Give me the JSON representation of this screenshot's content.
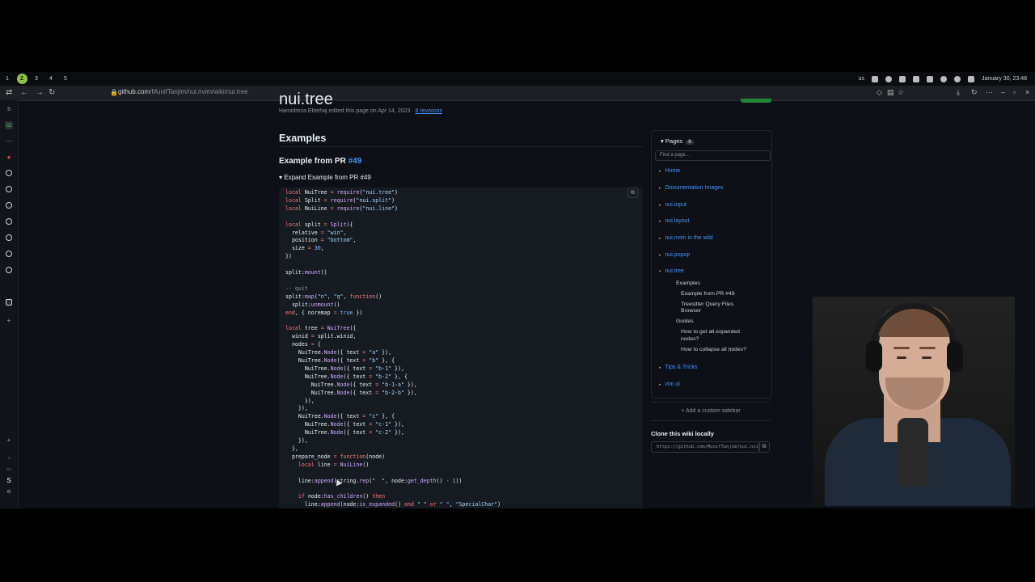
{
  "topbar": {
    "workspaces": [
      "1",
      "2",
      "3",
      "4",
      "5"
    ],
    "active_workspace": "2",
    "keyboard_layout": "us",
    "datetime": "January 30, 23:48"
  },
  "browser": {
    "url_host": "github.com",
    "url_path": "/MunifTanjim/nui.nvim/wiki/nui.tree"
  },
  "page": {
    "title_fragment": "nui.tree",
    "meta_text": "Hamidreza Ebtehaj edited this page on Apr 14, 2023 ·",
    "revisions_link": "8 revisions",
    "h2": "Examples",
    "h3_prefix": "Example from PR",
    "h3_link": "#49",
    "details_summary": "▾ Expand Example from PR #49"
  },
  "wiki_sidebar": {
    "pages_label": "Pages",
    "pages_count": "9",
    "find_placeholder": "Find a page…",
    "pages": [
      "Home",
      "Documentation Images",
      "nui.input",
      "nui.layout",
      "nui.nvim in the wild",
      "nui.popup",
      "nui.tree",
      "Tips & Tricks",
      "vim.ui"
    ],
    "tree_sections": {
      "examples_label": "Examples",
      "example_pr": "Example from PR #49",
      "treesitter_line1": "Treesitter Query Files",
      "treesitter_line2": "Browser",
      "guides_label": "Guides",
      "guide1_line1": "How to get all expanded",
      "guide1_line2": "nodes?",
      "guide2": "How to collapse all nodes?"
    },
    "add_sidebar": "+  Add a custom sidebar",
    "clone_heading": "Clone this wiki locally",
    "clone_url": "https://github.com/MunifTanjim/nui.nvim.wiki.git"
  },
  "colors": {
    "link": "#4493f8",
    "background": "#0d1117",
    "keyword": "#ff7b72",
    "string": "#a5d6ff",
    "active_workspace": "#8bc34a"
  }
}
